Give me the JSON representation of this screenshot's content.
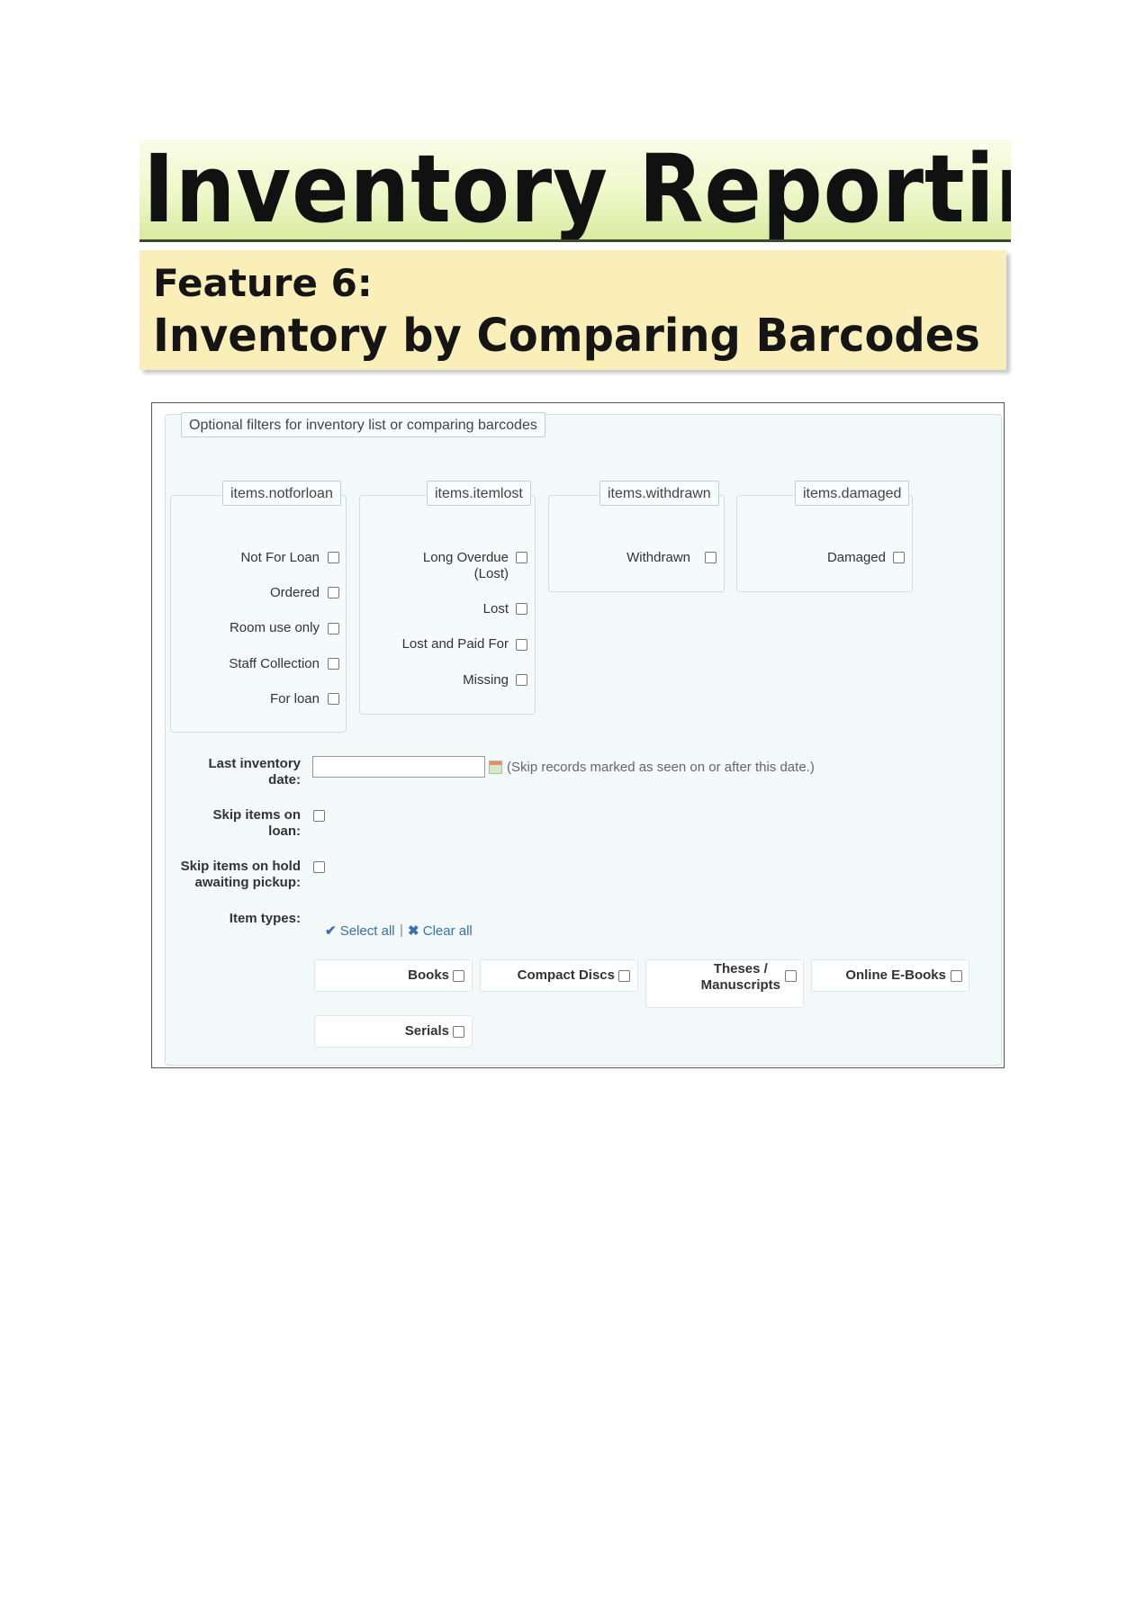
{
  "title": "Inventory Reporting",
  "feature": {
    "label": "Feature 6:",
    "name": "Inventory by Comparing Barcodes"
  },
  "form": {
    "legend": "Optional filters for inventory list or comparing barcodes",
    "groups": {
      "notforloan": {
        "legend": "items.notforloan",
        "options": [
          "Not For Loan",
          "Ordered",
          "Room use only",
          "Staff Collection",
          "For loan"
        ]
      },
      "itemlost": {
        "legend": "items.itemlost",
        "options": [
          "Long Overdue\n(Lost)",
          "Lost",
          "Lost and Paid For",
          "Missing"
        ]
      },
      "withdrawn": {
        "legend": "items.withdrawn",
        "options": [
          "Withdrawn"
        ]
      },
      "damaged": {
        "legend": "items.damaged",
        "options": [
          "Damaged"
        ]
      }
    },
    "last_inventory_label": "Last inventory\ndate:",
    "last_inventory_value": "",
    "last_inventory_hint": "(Skip records marked as seen on or after this date.)",
    "skip_on_loan_label": "Skip items on\nloan:",
    "skip_hold_label": "Skip items on hold\nawaiting pickup:",
    "item_types_label": "Item types:",
    "select_all": "Select all",
    "clear_all": "Clear all",
    "separator": "|",
    "item_types": [
      "Books",
      "Compact Discs",
      "Theses /\nManuscripts",
      "Online E-Books",
      "Serials"
    ]
  },
  "colors": {
    "link": "#3a6fb0",
    "panel_bg": "#f3f9f9",
    "feature_bg": "#fbefb9"
  }
}
